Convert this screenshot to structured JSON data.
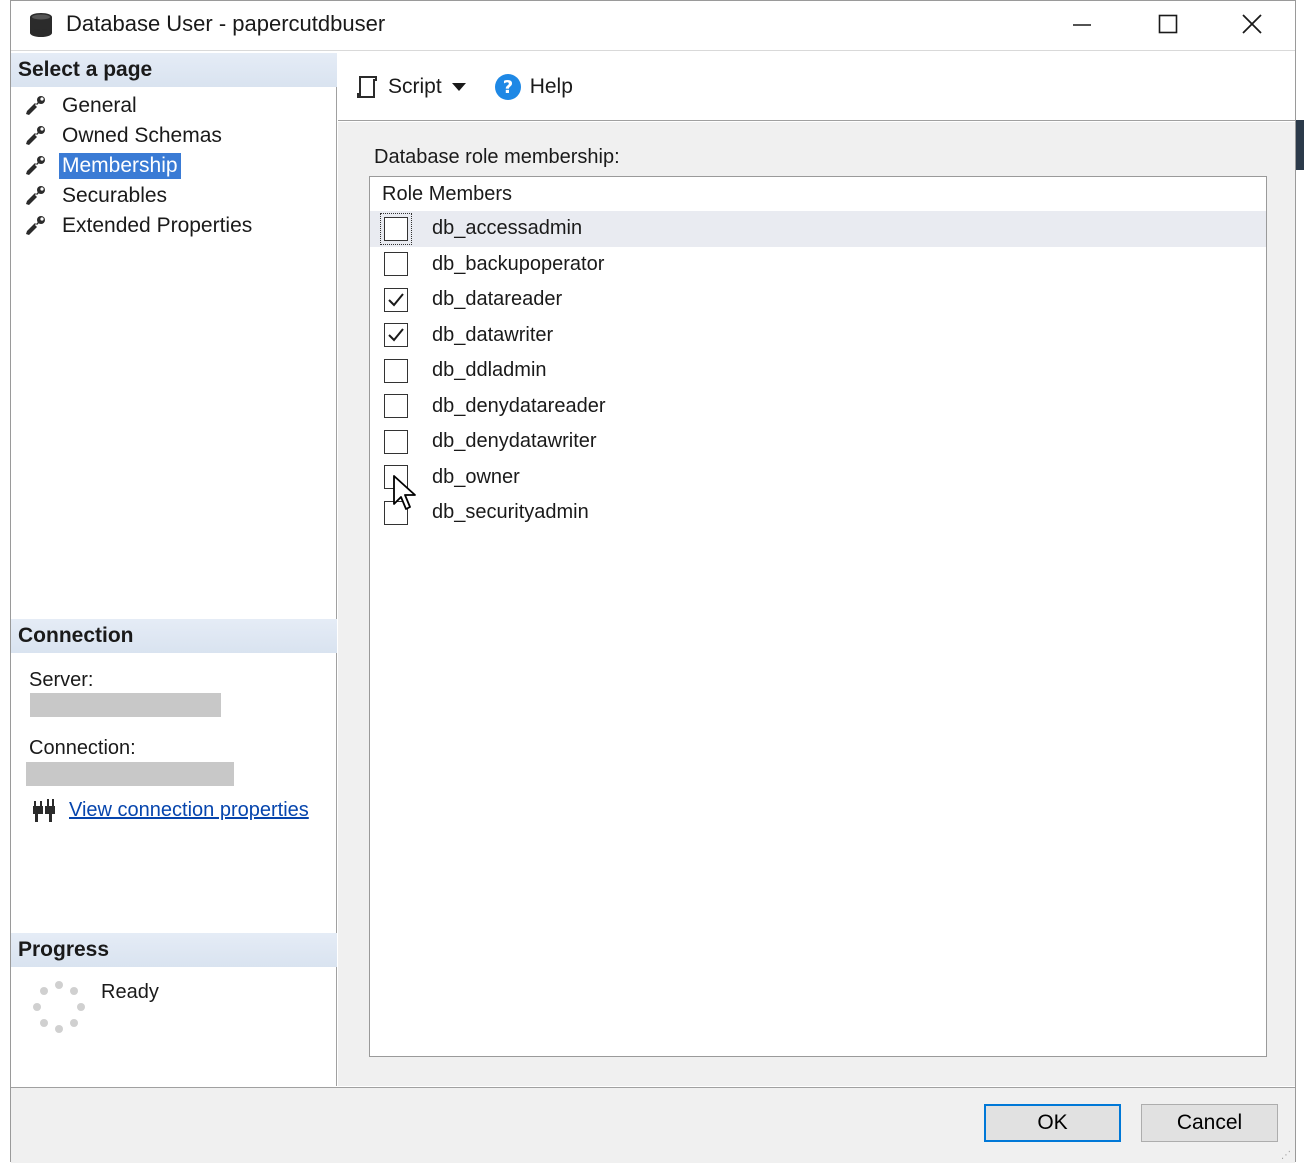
{
  "window": {
    "title": "Database User - papercutdbuser",
    "icon": "database-icon"
  },
  "left_panel": {
    "select_page_header": "Select a page",
    "pages": [
      {
        "label": "General",
        "icon": "wrench-icon",
        "selected": false
      },
      {
        "label": "Owned Schemas",
        "icon": "wrench-icon",
        "selected": false
      },
      {
        "label": "Membership",
        "icon": "wrench-icon",
        "selected": true
      },
      {
        "label": "Securables",
        "icon": "wrench-icon",
        "selected": false
      },
      {
        "label": "Extended Properties",
        "icon": "wrench-icon",
        "selected": false
      }
    ],
    "connection_header": "Connection",
    "server_label": "Server:",
    "connection_label": "Connection:",
    "view_connection_properties": "View connection properties",
    "progress_header": "Progress",
    "progress_status": "Ready"
  },
  "toolbar": {
    "script_label": "Script",
    "help_label": "Help"
  },
  "content": {
    "role_membership_caption": "Database role membership:",
    "role_members_header": "Role Members",
    "roles": [
      {
        "name": "db_accessadmin",
        "checked": false
      },
      {
        "name": "db_backupoperator",
        "checked": false
      },
      {
        "name": "db_datareader",
        "checked": true
      },
      {
        "name": "db_datawriter",
        "checked": true
      },
      {
        "name": "db_ddladmin",
        "checked": false
      },
      {
        "name": "db_denydatareader",
        "checked": false
      },
      {
        "name": "db_denydatawriter",
        "checked": false
      },
      {
        "name": "db_owner",
        "checked": false
      },
      {
        "name": "db_securityadmin",
        "checked": false
      }
    ]
  },
  "buttons": {
    "ok": "OK",
    "cancel": "Cancel"
  },
  "colors": {
    "selection": "#3a7bd5",
    "link": "#0645ad",
    "section_header": "#dfe7f2"
  }
}
